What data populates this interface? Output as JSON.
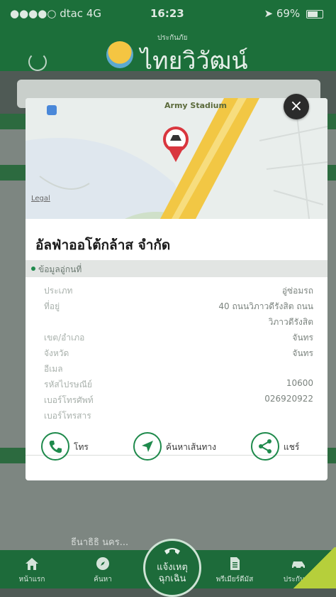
{
  "status_bar": {
    "carrier": "●●●●○ dtac  4G",
    "time": "16:23",
    "battery": "69%",
    "battery_fraction": 0.69
  },
  "header": {
    "logo_small": "ประกันภัย",
    "logo_text": "ไทยวิวัฒน์"
  },
  "background": {
    "row_text": "ธีนาธิธิ นคร..."
  },
  "modal": {
    "map_label_stadium": "Army Stadium",
    "map_label_legal": "Legal",
    "title": "อัลฟ่าออโต้กล้าส จำกัด",
    "section": "ข้อมูลอู่กนที่",
    "rows": [
      {
        "label": "ประเภท",
        "value": "อู่ซ่อมรถ"
      },
      {
        "label": "ที่อยู่",
        "value": "40 ถนนวิภาวดีรังสิต ถนน"
      },
      {
        "label": "",
        "value": "วิภาวดีรังสิต"
      },
      {
        "label": "เขต/อำเภอ",
        "value": "จันทร"
      },
      {
        "label": "จังหวัด",
        "value": "จันทร"
      },
      {
        "label": "อีเมล",
        "value": ""
      },
      {
        "label": "รหัสไปรษณีย์",
        "value": "10600"
      },
      {
        "label": "เบอร์โทรศัพท์",
        "value": "026920922"
      },
      {
        "label": "เบอร์โทรสาร",
        "value": ""
      }
    ],
    "actions": {
      "call": "โทร",
      "navigate": "ค้นหาเส้นทาง",
      "share": "แชร์"
    },
    "close_icon": "close-icon"
  },
  "tabs": {
    "home": "หน้าแรก",
    "explore": "ค้นหา",
    "emergency": "แจ้งเหตุ ฉุกเฉิน",
    "policy": "พรีเมียร์ดีมัส",
    "insure": "ประกันภัย"
  },
  "colors": {
    "primary": "#1c6f3a",
    "accent": "#1f8a4c",
    "map_road": "#f2c744",
    "pin": "#d9363e"
  }
}
